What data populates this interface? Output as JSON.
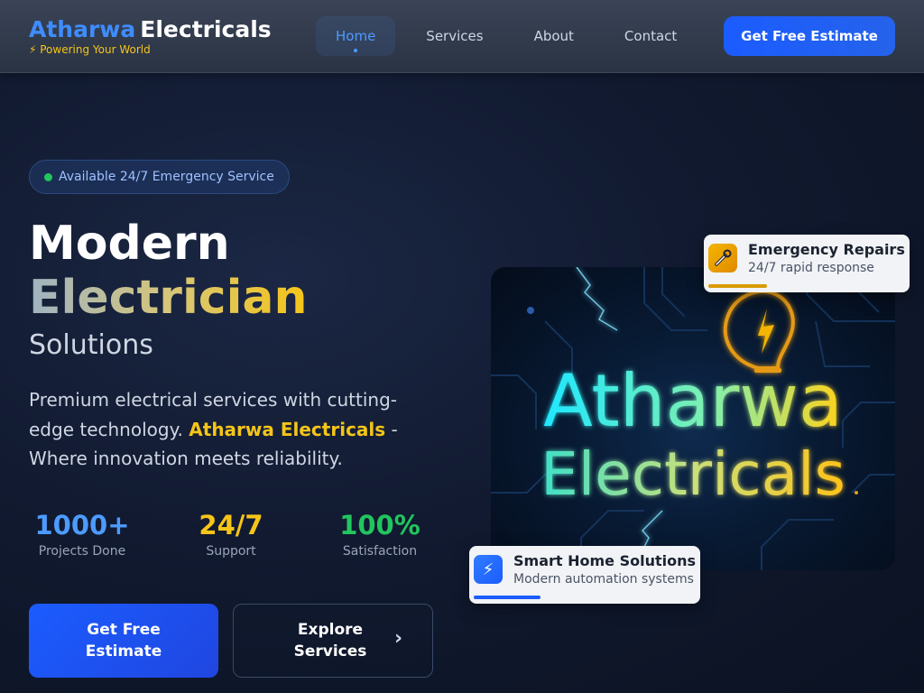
{
  "brand": {
    "name_part1": "Atharwa",
    "name_part2": "Electricals",
    "tagline": "⚡ Powering Your World"
  },
  "nav": {
    "links": [
      {
        "label": "Home",
        "active": true
      },
      {
        "label": "Services",
        "active": false
      },
      {
        "label": "About",
        "active": false
      },
      {
        "label": "Contact",
        "active": false
      }
    ],
    "cta_label": "Get Free Estimate"
  },
  "hero": {
    "badge": "Available 24/7 Emergency Service",
    "title_line1": "Modern",
    "title_line2": "Electrician",
    "title_line3": "Solutions",
    "description_part1": "Premium electrical services with cutting-edge technology. ",
    "description_highlight": "Atharwa Electricals",
    "description_part2": " - Where innovation meets reliability.",
    "stats": [
      {
        "value": "1000+",
        "label": "Projects Done",
        "color": "#4d9bff"
      },
      {
        "value": "24/7",
        "label": "Support",
        "color": "#f5c518"
      },
      {
        "value": "100%",
        "label": "Satisfaction",
        "color": "#22c55e"
      }
    ],
    "primary_button": "Get Free Estimate",
    "secondary_button": "Explore Services",
    "image_text_line1": "Atharwa",
    "image_text_line2": "Electricals"
  },
  "cards": {
    "emergency": {
      "title": "Emergency Repairs",
      "subtitle": "24/7 rapid response",
      "icon": "wrench-icon"
    },
    "smart_home": {
      "title": "Smart Home Solutions",
      "subtitle": "Modern automation systems",
      "icon": "lightning-icon",
      "glyph": "⚡"
    }
  },
  "colors": {
    "accent_blue": "#1b5cff",
    "accent_yellow": "#f5c518",
    "accent_green": "#22c55e",
    "background": "#111a30"
  }
}
